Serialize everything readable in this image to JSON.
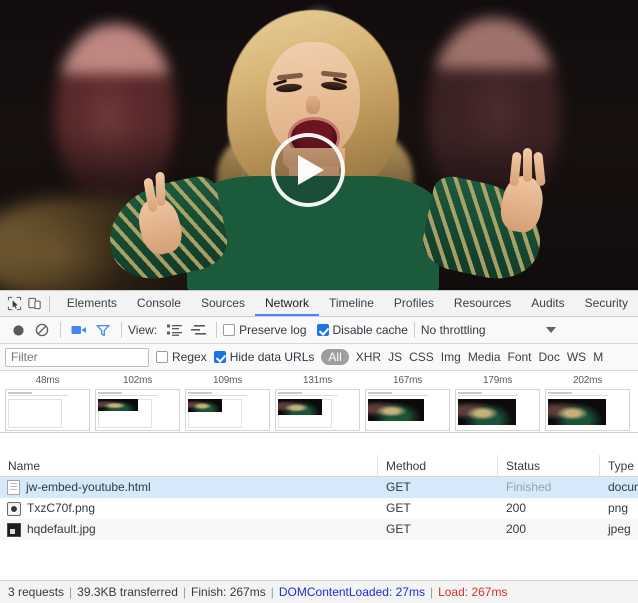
{
  "viewport": {
    "media_label": "video-thumbnail",
    "play_button_label": "Play"
  },
  "devtools": {
    "left_icons": [
      {
        "name": "inspect-element-icon",
        "glyph": "inspect"
      },
      {
        "name": "device-toolbar-icon",
        "glyph": "device"
      }
    ],
    "tabs": [
      {
        "label": "Elements",
        "active": false
      },
      {
        "label": "Console",
        "active": false
      },
      {
        "label": "Sources",
        "active": false
      },
      {
        "label": "Network",
        "active": true
      },
      {
        "label": "Timeline",
        "active": false
      },
      {
        "label": "Profiles",
        "active": false
      },
      {
        "label": "Resources",
        "active": false
      },
      {
        "label": "Audits",
        "active": false
      },
      {
        "label": "Security",
        "active": false
      }
    ],
    "toolbar": {
      "record_label": "Record",
      "clear_label": "Clear",
      "capture_screenshots_label": "Capture screenshots",
      "filter_toggle_label": "Filter",
      "view_label": "View:",
      "view_list_label": "Use large request rows",
      "view_waterfall_label": "Show overview",
      "preserve_log_label": "Preserve log",
      "preserve_log_checked": false,
      "disable_cache_label": "Disable cache",
      "disable_cache_checked": true,
      "throttling_value": "No throttling"
    },
    "filterbar": {
      "filter_placeholder": "Filter",
      "filter_value": "",
      "regex_label": "Regex",
      "regex_checked": false,
      "hide_data_urls_label": "Hide data URLs",
      "hide_data_urls_checked": true,
      "types": [
        {
          "label": "All",
          "selected": true
        },
        {
          "label": "XHR",
          "selected": false
        },
        {
          "label": "JS",
          "selected": false
        },
        {
          "label": "CSS",
          "selected": false
        },
        {
          "label": "Img",
          "selected": false
        },
        {
          "label": "Media",
          "selected": false
        },
        {
          "label": "Font",
          "selected": false
        },
        {
          "label": "Doc",
          "selected": false
        },
        {
          "label": "WS",
          "selected": false
        },
        {
          "label": "M",
          "selected": false
        }
      ]
    },
    "filmstrip": [
      {
        "time": "48ms",
        "progress": 0
      },
      {
        "time": "102ms",
        "progress": 1
      },
      {
        "time": "109ms",
        "progress": 2
      },
      {
        "time": "131ms",
        "progress": 3
      },
      {
        "time": "167ms",
        "progress": 4
      },
      {
        "time": "179ms",
        "progress": 5
      },
      {
        "time": "202ms",
        "progress": 6
      }
    ],
    "table": {
      "columns": [
        "Name",
        "Method",
        "Status",
        "Type"
      ],
      "rows": [
        {
          "icon": "document-icon",
          "name": "jw-embed-youtube.html",
          "method": "GET",
          "status": "Finished",
          "status_pending": true,
          "type": "docume",
          "selected": true
        },
        {
          "icon": "png-file-icon",
          "name": "TxzC70f.png",
          "method": "GET",
          "status": "200",
          "status_pending": false,
          "type": "png",
          "selected": false
        },
        {
          "icon": "image-file-icon",
          "name": "hqdefault.jpg",
          "method": "GET",
          "status": "200",
          "status_pending": false,
          "type": "jpeg",
          "selected": false
        }
      ]
    },
    "statusbar": {
      "requests": "3 requests",
      "transferred": "39.3KB transferred",
      "finish": "Finish: 267ms",
      "dom_content_loaded": "DOMContentLoaded: 27ms",
      "load": "Load: 267ms",
      "separator": "|"
    }
  },
  "colors": {
    "accent": "#4688f1",
    "checkbox": "#1a73e8",
    "selected_row": "#d6e9fb",
    "dcl": "#1a2fd4",
    "load": "#d93025",
    "pill": "#9e9e9e"
  }
}
